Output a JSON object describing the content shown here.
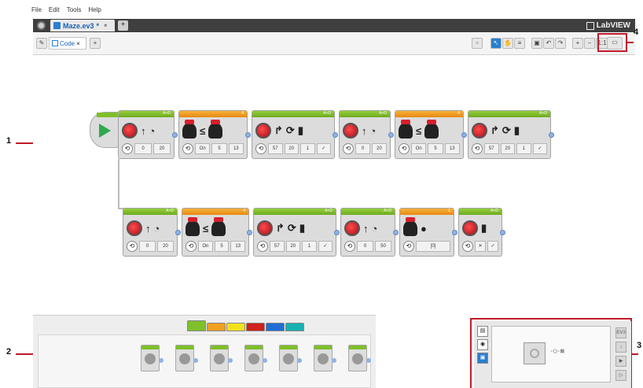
{
  "menu": {
    "file": "File",
    "edit": "Edit",
    "tools": "Tools",
    "help": "Help"
  },
  "project_tab": {
    "label": "Maze.ev3",
    "modified": "*",
    "close": "×",
    "add": "+"
  },
  "brand": {
    "logo_text": "LabVIEW"
  },
  "code_tab": {
    "label": "Code",
    "close": "×",
    "add": "+"
  },
  "zoom": {
    "reset": "1:1"
  },
  "callouts": {
    "one": "1",
    "two": "2",
    "three": "3",
    "four": "4"
  },
  "colors": {
    "callout_red": "#c01a2a",
    "action_green": "#7fbf2a",
    "flow_orange": "#f0a020",
    "selected_blue": "#2a7fd0"
  },
  "program": {
    "row1": [
      {
        "type": "move-steering",
        "port": "A+D",
        "icons": [
          "steering-motor-icon",
          "up-arrow-icon",
          "timer-icon"
        ],
        "params": [
          "0",
          "20"
        ]
      },
      {
        "type": "wait",
        "port": "4",
        "icons": [
          "hourglass-icon",
          "le-icon",
          "sensor-icon"
        ],
        "params": [
          "On",
          "5",
          "13"
        ]
      },
      {
        "type": "move-steering",
        "port": "A+D",
        "icons": [
          "steering-motor-icon",
          "turn-icon",
          "rotation-icon",
          "brake-icon"
        ],
        "params": [
          "57",
          "20",
          "1",
          "✓"
        ]
      },
      {
        "type": "move-steering",
        "port": "A+D",
        "icons": [
          "steering-motor-icon",
          "up-arrow-icon",
          "timer-icon"
        ],
        "params": [
          "0",
          "20"
        ]
      },
      {
        "type": "wait",
        "port": "4",
        "icons": [
          "hourglass-icon",
          "le-icon",
          "sensor-icon"
        ],
        "params": [
          "On",
          "5",
          "13"
        ]
      },
      {
        "type": "move-steering",
        "port": "A+D",
        "icons": [
          "steering-motor-icon",
          "turn-icon",
          "rotation-icon",
          "brake-icon"
        ],
        "params": [
          "57",
          "20",
          "1",
          "✓"
        ]
      }
    ],
    "row2": [
      {
        "type": "move-steering",
        "port": "A+D",
        "icons": [
          "steering-motor-icon",
          "up-arrow-icon",
          "timer-icon"
        ],
        "params": [
          "0",
          "20"
        ]
      },
      {
        "type": "wait",
        "port": "4",
        "icons": [
          "hourglass-icon",
          "le-icon",
          "sensor-icon"
        ],
        "params": [
          "On",
          "5",
          "13"
        ]
      },
      {
        "type": "move-steering",
        "port": "A+D",
        "icons": [
          "steering-motor-icon",
          "turn-icon",
          "rotation-icon",
          "brake-icon"
        ],
        "params": [
          "57",
          "20",
          "1",
          "✓"
        ]
      },
      {
        "type": "move-steering",
        "port": "A+D",
        "icons": [
          "steering-motor-icon",
          "up-arrow-icon",
          "timer-icon"
        ],
        "params": [
          "0",
          "50"
        ]
      },
      {
        "type": "wait",
        "port": "1",
        "icons": [
          "hourglass-icon",
          "touch-sensor-icon"
        ],
        "params": [
          "[0]"
        ]
      },
      {
        "type": "move-steering-off",
        "port": "A+D",
        "icons": [
          "steering-motor-icon",
          "brake-icon"
        ],
        "params": [
          "✕",
          "✓"
        ]
      }
    ]
  },
  "palette": {
    "categories": [
      "Action",
      "Flow Control",
      "Sensor",
      "Data Operations",
      "Advanced",
      "My Blocks"
    ],
    "category_colors": [
      "#7fbf2a",
      "#f0a020",
      "#f2e21a",
      "#d0211b",
      "#1f6ed4",
      "#19b0b0"
    ]
  },
  "hardware_page": {
    "tabs": [
      "brick-info-icon",
      "port-view-icon",
      "available-bricks-icon"
    ],
    "side_buttons": [
      "EV3",
      "↓",
      "▶",
      "▷"
    ]
  }
}
